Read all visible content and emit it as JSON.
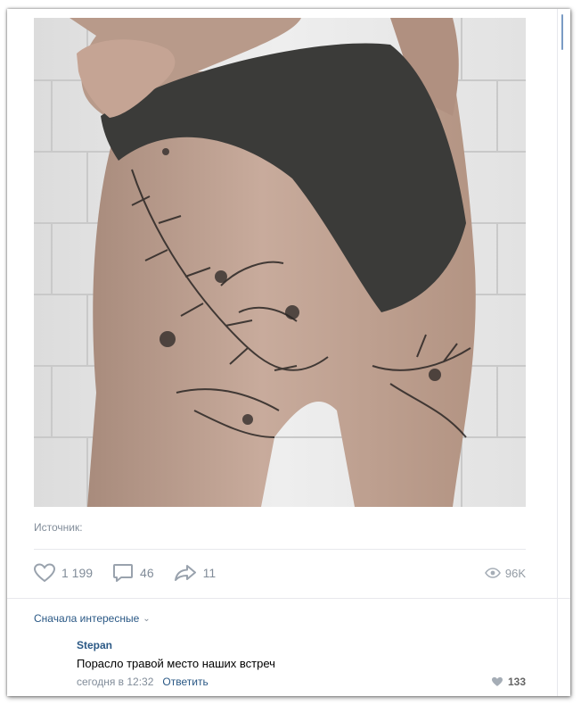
{
  "post": {
    "photo_alt": "",
    "source_label": "Источник:"
  },
  "actions": {
    "likes": "1 199",
    "comments": "46",
    "shares": "11",
    "views": "96K"
  },
  "icons": {
    "like": "heart-icon",
    "comment": "comment-icon",
    "share": "share-icon",
    "views": "eye-icon",
    "comment_like": "heart-icon"
  },
  "comments_section": {
    "sort_label": "Сначала интересные",
    "items": [
      {
        "author": "Stepan",
        "text": "Порасло травой место наших встреч",
        "time": "сегодня в 12:32",
        "reply_label": "Ответить",
        "likes": "133"
      }
    ]
  },
  "colors": {
    "link": "#2a5885",
    "muted": "#818c99",
    "divider": "#e7e8ec"
  }
}
